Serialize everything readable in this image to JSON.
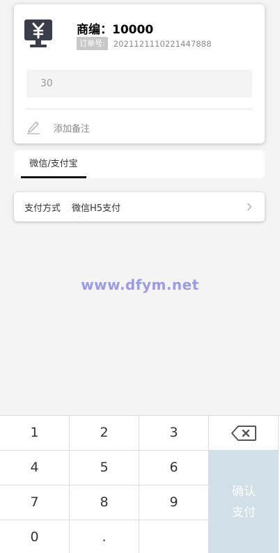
{
  "merchant": {
    "line": "商编：10000",
    "icon": "desktop-yuan-icon"
  },
  "order": {
    "label": "订单号:",
    "number": "2021121110221447888"
  },
  "amount": {
    "value": "30"
  },
  "remark": {
    "icon": "pencil-icon",
    "label": "添加备注"
  },
  "tabs": [
    {
      "label": "微信/支付宝",
      "active": true
    }
  ],
  "payment": {
    "label": "支付方式",
    "method": "微信H5支付",
    "icon": "chevron-right-icon"
  },
  "watermark": "www.dfym.net",
  "keypad": {
    "keys": [
      "1",
      "2",
      "3",
      "4",
      "5",
      "6",
      "7",
      "8",
      "9",
      "0",
      "."
    ],
    "delete_icon": "backspace-icon",
    "confirm_line1": "确认",
    "confirm_line2": "支付",
    "confirm_color": "#d0dfe8"
  }
}
